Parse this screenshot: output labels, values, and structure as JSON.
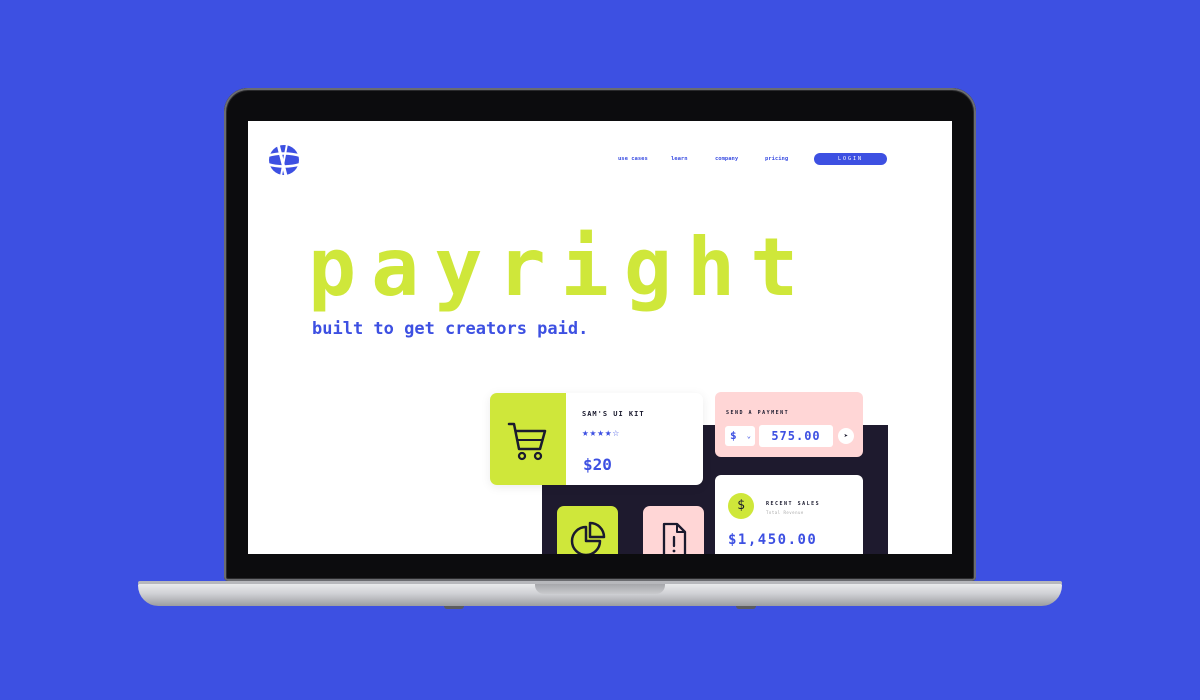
{
  "colors": {
    "background": "#3d50e2",
    "accent": "#3d50e2",
    "lime": "#cfe73a",
    "pink": "#ffd6d6",
    "dark": "#1e1a2e"
  },
  "header": {
    "logo_icon": "payright-logo-icon",
    "nav": [
      "use cases",
      "learn",
      "company",
      "pricing"
    ],
    "login_label": "LOGIN"
  },
  "hero": {
    "title": "payright",
    "subtitle": "built to get creators paid."
  },
  "product_card": {
    "icon": "shopping-cart-icon",
    "name": "SAM'S UI KIT",
    "rating": 4,
    "rating_max": 5,
    "stars_text": "★★★★☆",
    "price": "$20"
  },
  "payment_card": {
    "label": "SEND A PAYMENT",
    "currency": "$",
    "amount": "575.00",
    "send_icon": "send-arrow-icon"
  },
  "sales_card": {
    "icon": "dollar-icon",
    "label": "RECENT SALES",
    "sublabel": "Total Revenue",
    "amount": "$1,450.00"
  },
  "tiles": [
    {
      "icon": "pie-chart-icon"
    },
    {
      "icon": "document-alert-icon"
    }
  ]
}
